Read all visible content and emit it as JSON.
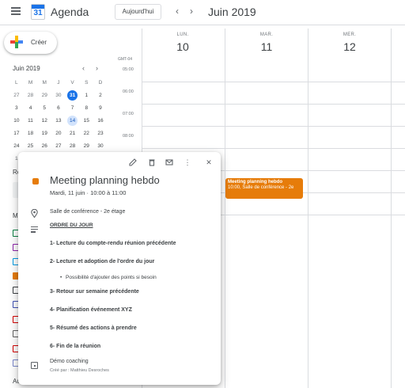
{
  "header": {
    "app_title": "Agenda",
    "logo_day": "31",
    "today_label": "Aujourd'hui",
    "prev_icon": "chevron-left-icon",
    "next_icon": "chevron-right-icon",
    "current_range": "Juin 2019"
  },
  "sidebar": {
    "create_label": "Créer",
    "mini_calendar": {
      "month_label": "Juin 2019",
      "weekdays": [
        "L",
        "M",
        "M",
        "J",
        "V",
        "S",
        "D"
      ],
      "weeks": [
        [
          "27",
          "28",
          "29",
          "30",
          "31",
          "1",
          "2"
        ],
        [
          "3",
          "4",
          "5",
          "6",
          "7",
          "8",
          "9"
        ],
        [
          "10",
          "11",
          "12",
          "13",
          "14",
          "15",
          "16"
        ],
        [
          "17",
          "18",
          "19",
          "20",
          "21",
          "22",
          "23"
        ],
        [
          "24",
          "25",
          "26",
          "27",
          "28",
          "29",
          "30"
        ],
        [
          "1",
          "",
          "",
          "",
          "",
          "",
          ""
        ]
      ]
    },
    "section_r_label": "Re",
    "section_m_label": "M",
    "section_a_label": "Au",
    "calendar_colors": [
      "#0b8043",
      "#8e24aa",
      "#039be5",
      "#e67c0a",
      "#3c4043",
      "#3f51b5",
      "#d50000",
      "#616161",
      "#d50000",
      "#7986cb"
    ]
  },
  "week": {
    "timezone": "GMT-04",
    "days": [
      {
        "dow": "LUN.",
        "num": "10"
      },
      {
        "dow": "MAR.",
        "num": "11"
      },
      {
        "dow": "MER.",
        "num": "12"
      }
    ],
    "hours": [
      "05:00",
      "06:00",
      "07:00",
      "08:00"
    ]
  },
  "event": {
    "title": "Meeting planning hebdo",
    "subtitle": "10:00, Salle de conférence - 2e",
    "color": "#e67c0a"
  },
  "popup": {
    "title": "Meeting planning hebdo",
    "date": "Mardi, 11 juin  ·  10:00 à 11:00",
    "location": "Salle de conférence - 2e étage",
    "agenda_heading": "ORDRE DU JOUR",
    "items": [
      "1- Lecture du compte-rendu réunion précédente",
      "2- Lecture et adoption de l'ordre du jour",
      "3- Retour sur semaine précédente",
      "4- Planification événement XYZ",
      "5- Résumé des actions à prendre",
      "6- Fin de la réunion"
    ],
    "sub_item": "Possibilité d'ajouter des points si besoin",
    "calendar_name": "Démo coaching",
    "creator": "Créé par : Matthieu Desroches"
  }
}
